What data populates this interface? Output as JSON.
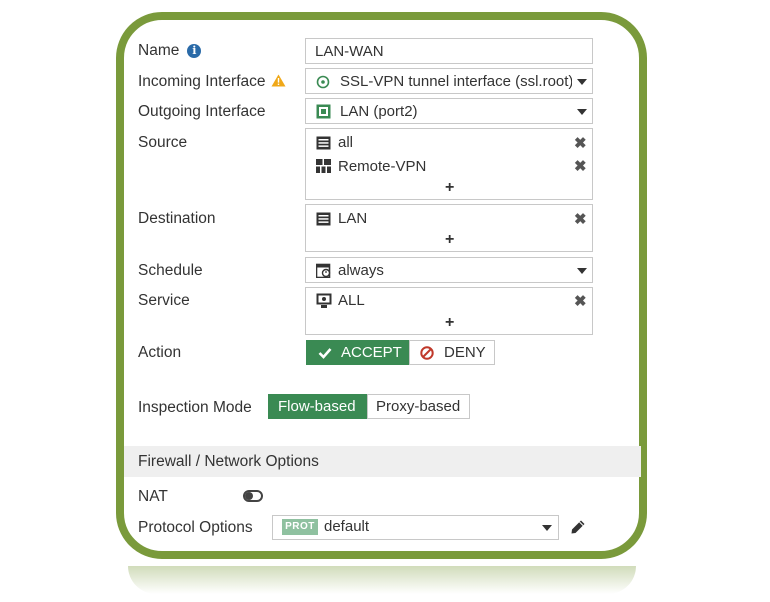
{
  "fields": {
    "name": {
      "label": "Name",
      "value": "LAN-WAN"
    },
    "incoming": {
      "label": "Incoming Interface",
      "value": "SSL-VPN tunnel interface (ssl.root)"
    },
    "outgoing": {
      "label": "Outgoing Interface",
      "value": "LAN (port2)"
    },
    "source": {
      "label": "Source",
      "items": [
        "all",
        "Remote-VPN"
      ]
    },
    "destination": {
      "label": "Destination",
      "items": [
        "LAN"
      ]
    },
    "schedule": {
      "label": "Schedule",
      "value": "always"
    },
    "service": {
      "label": "Service",
      "items": [
        "ALL"
      ]
    },
    "action": {
      "label": "Action",
      "accept": "ACCEPT",
      "deny": "DENY",
      "selected": "ACCEPT"
    },
    "inspection": {
      "label": "Inspection Mode",
      "flow": "Flow-based",
      "proxy": "Proxy-based",
      "selected": "Flow-based"
    }
  },
  "section": {
    "title": "Firewall / Network Options"
  },
  "nat": {
    "label": "NAT",
    "enabled": false
  },
  "protocol": {
    "label": "Protocol Options",
    "badge": "PROT",
    "value": "default"
  },
  "symbols": {
    "info": "i",
    "remove": "✖",
    "add": "+"
  },
  "colors": {
    "frame": "#7a9a3b",
    "accept": "#3a8a53",
    "deny": "#c0392b",
    "info": "#2a6aa8",
    "warning": "#f0a818"
  }
}
